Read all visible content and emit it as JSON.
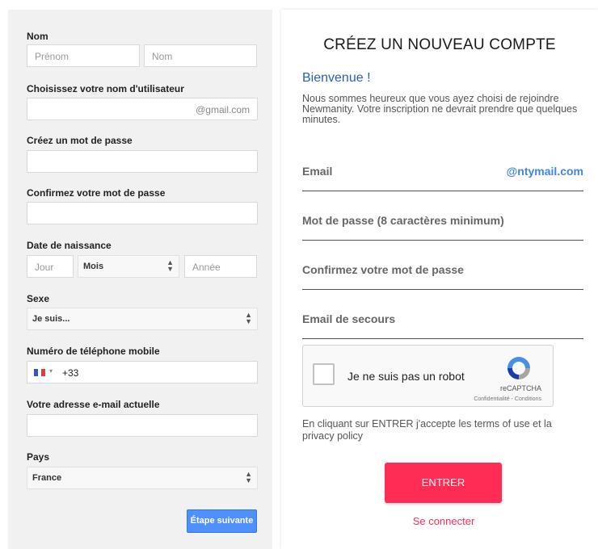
{
  "left_form": {
    "name_label": "Nom",
    "first_name_placeholder": "Prénom",
    "last_name_placeholder": "Nom",
    "username_label": "Choisissez votre nom d'utilisateur",
    "username_suffix": "@gmail.com",
    "password_label": "Créez un mot de passe",
    "confirm_password_label": "Confirmez votre mot de passe",
    "birthdate_label": "Date de naissance",
    "day_placeholder": "Jour",
    "month_value": "Mois",
    "year_placeholder": "Année",
    "gender_label": "Sexe",
    "gender_value": "Je suis...",
    "phone_label": "Numéro de téléphone mobile",
    "phone_prefix": "+33",
    "current_email_label": "Votre adresse e-mail actuelle",
    "country_label": "Pays",
    "country_value": "France",
    "next_button": "Étape suivante"
  },
  "right_form": {
    "title": "CRÉEZ UN NOUVEAU COMPTE",
    "welcome": "Bienvenue !",
    "intro": "Nous sommes heureux que vous ayez choisi de rejoindre Newmanity. Votre inscription ne devrait prendre que quelques minutes.",
    "email_label": "Email",
    "email_domain": "@ntymail.com",
    "password_label": "Mot de passe (8 caractères minimum)",
    "confirm_password_label": "Confirmez votre mot de passe",
    "backup_email_label": "Email de secours",
    "captcha_text": "Je ne suis pas un robot",
    "captcha_brand": "reCAPTCHA",
    "captcha_links": "Confidentialité - Conditions",
    "terms": "En cliquant sur ENTRER j'accepte les terms of use et la privacy policy",
    "enter_button": "ENTRER",
    "login_link": "Se connecter"
  },
  "colors": {
    "accent_blue": "#4d90fe",
    "brand_pink": "#ff2d55",
    "link_blue": "#3f86e0"
  }
}
